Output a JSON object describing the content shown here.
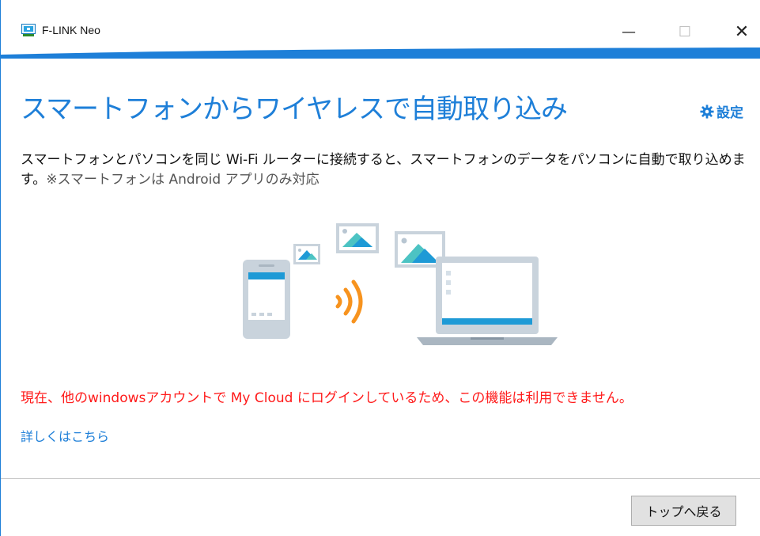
{
  "window": {
    "title": "F-LINK Neo",
    "minimize": "—",
    "maximize": "☐",
    "close": "✕"
  },
  "page": {
    "heading": "スマートフォンからワイヤレスで自動取り込み",
    "settings_label": "設定",
    "description": "スマートフォンとパソコンを同じ Wi-Fi ルーターに接続すると、スマートフォンのデータをパソコンに自動で取り込めます。",
    "description_note": "※スマートフォンは Android アプリのみ対応",
    "warning": "現在、他のwindowsアカウントで My Cloud にログインしているため、この機能は利用できません。",
    "details_link": "詳しくはこちら",
    "back_button": "トップへ戻る"
  },
  "colors": {
    "accent": "#1e7fd8",
    "warning": "#ff1a1a",
    "wifi": "#f7931e"
  },
  "icons": [
    "app-icon",
    "minimize-icon",
    "maximize-icon",
    "close-icon",
    "gear-icon",
    "smartphone-icon",
    "wifi-signal-icon",
    "photo-icon",
    "laptop-icon"
  ]
}
